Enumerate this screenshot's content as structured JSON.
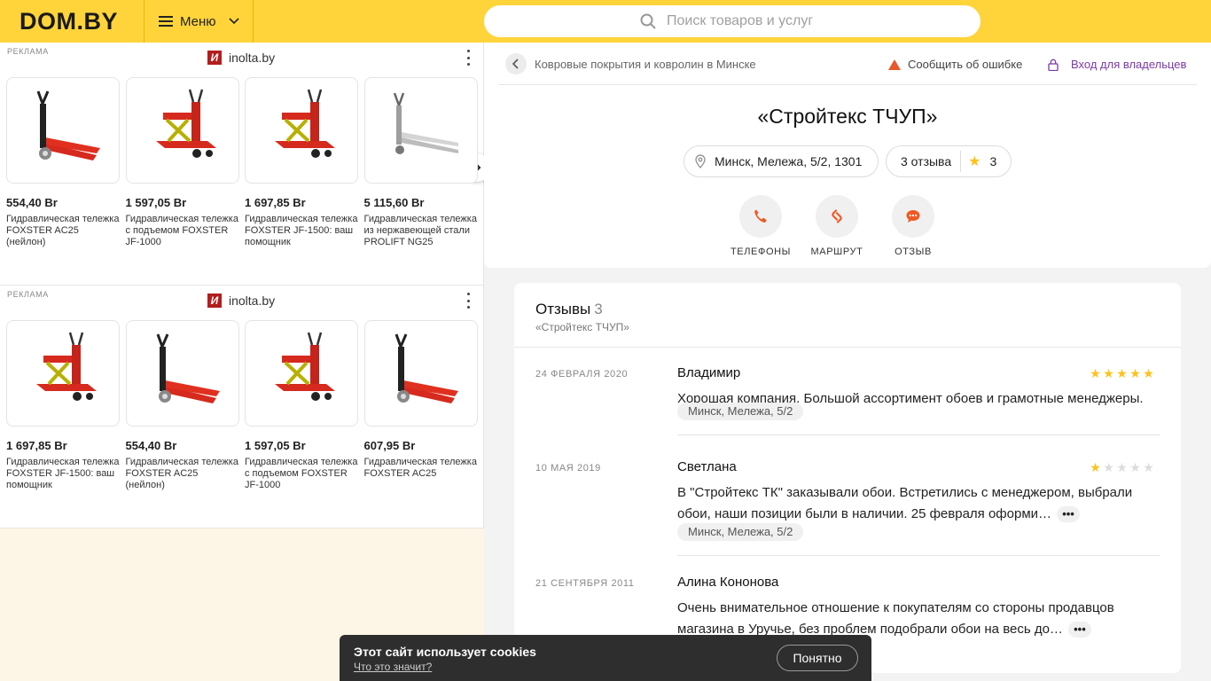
{
  "header": {
    "logo": "DOM.BY",
    "menu_label": "Меню",
    "search_placeholder": "Поиск товаров и услуг"
  },
  "ads": [
    {
      "label": "РЕКЛАМА",
      "brand_logo": "И",
      "brand": "inolta.by",
      "items": [
        {
          "price": "554,40 Br",
          "desc": "Гидравлическая тележка FOXSTER AC25 (нейлон)",
          "kind": "pallet"
        },
        {
          "price": "1 597,05 Br",
          "desc": "Гидравлическая тележка с подъемом FOXSTER JF-1000",
          "kind": "scissor"
        },
        {
          "price": "1 697,85 Br",
          "desc": "Гидравлическая тележка FOXSTER JF-1500: ваш помощник",
          "kind": "scissor"
        },
        {
          "price": "5 115,60 Br",
          "desc": "Гидравлическая тележка из нержавеющей стали PROLIFT NG25",
          "kind": "steel"
        }
      ]
    },
    {
      "label": "РЕКЛАМА",
      "brand_logo": "И",
      "brand": "inolta.by",
      "items": [
        {
          "price": "1 697,85 Br",
          "desc": "Гидравлическая тележка FOXSTER JF-1500: ваш помощник",
          "kind": "scissor"
        },
        {
          "price": "554,40 Br",
          "desc": "Гидравлическая тележка FOXSTER AC25 (нейлон)",
          "kind": "pallet"
        },
        {
          "price": "1 597,05 Br",
          "desc": "Гидравлическая тележка с подъемом FOXSTER JF-1000",
          "kind": "scissor"
        },
        {
          "price": "607,95 Br",
          "desc": "Гидравлическая тележка FOXSTER AC25",
          "kind": "pallet"
        }
      ]
    }
  ],
  "company": {
    "breadcrumb": "Ковровые покрытия и ковролин в Минске",
    "report_error": "Сообщить об ошибке",
    "owners_login": "Вход для владельцев",
    "title": "«Стройтекс ТЧУП»",
    "address": "Минск, Мележа, 5/2, 1301",
    "reviews_count_label": "3 отзыва",
    "rating": "3",
    "actions": {
      "phones": "ТЕЛЕФОНЫ",
      "route": "МАРШРУТ",
      "review": "ОТЗЫВ"
    }
  },
  "reviews": {
    "heading": "Отзывы",
    "count": "3",
    "subtitle": "«Стройтекс ТЧУП»",
    "items": [
      {
        "date": "24 ФЕВРАЛЯ 2020",
        "author": "Владимир",
        "stars": 5,
        "text": "Хорошая компания. Большой ассортимент обоев и грамотные менеджеры.",
        "more": "",
        "tag": "Минск, Мележа, 5/2"
      },
      {
        "date": "10 МАЯ 2019",
        "author": "Светлана",
        "stars": 1,
        "text": "В \"Стройтекс ТК\" заказывали обои. Встретились с менеджером, выбрали обои, наши позиции были в наличии. 25 февраля оформи…",
        "more": "•••",
        "tag": "Минск, Мележа, 5/2"
      },
      {
        "date": "21 СЕНТЯБРЯ 2011",
        "author": "Алина Кононова",
        "stars": 0,
        "text": "Очень внимательное отношение к покупателям со стороны продавцов магазина в Уручье, без проблем подобрали обои на весь до…",
        "more": "•••",
        "tag": ""
      }
    ]
  },
  "cookie": {
    "title": "Этот сайт использует cookies",
    "link": "Что это значит?",
    "button": "Понятно"
  },
  "colors": {
    "brand_yellow": "#ffd43b",
    "action_orange": "#ee5a24",
    "owner_purple": "#7a3aa6",
    "star": "#ffc21a"
  }
}
